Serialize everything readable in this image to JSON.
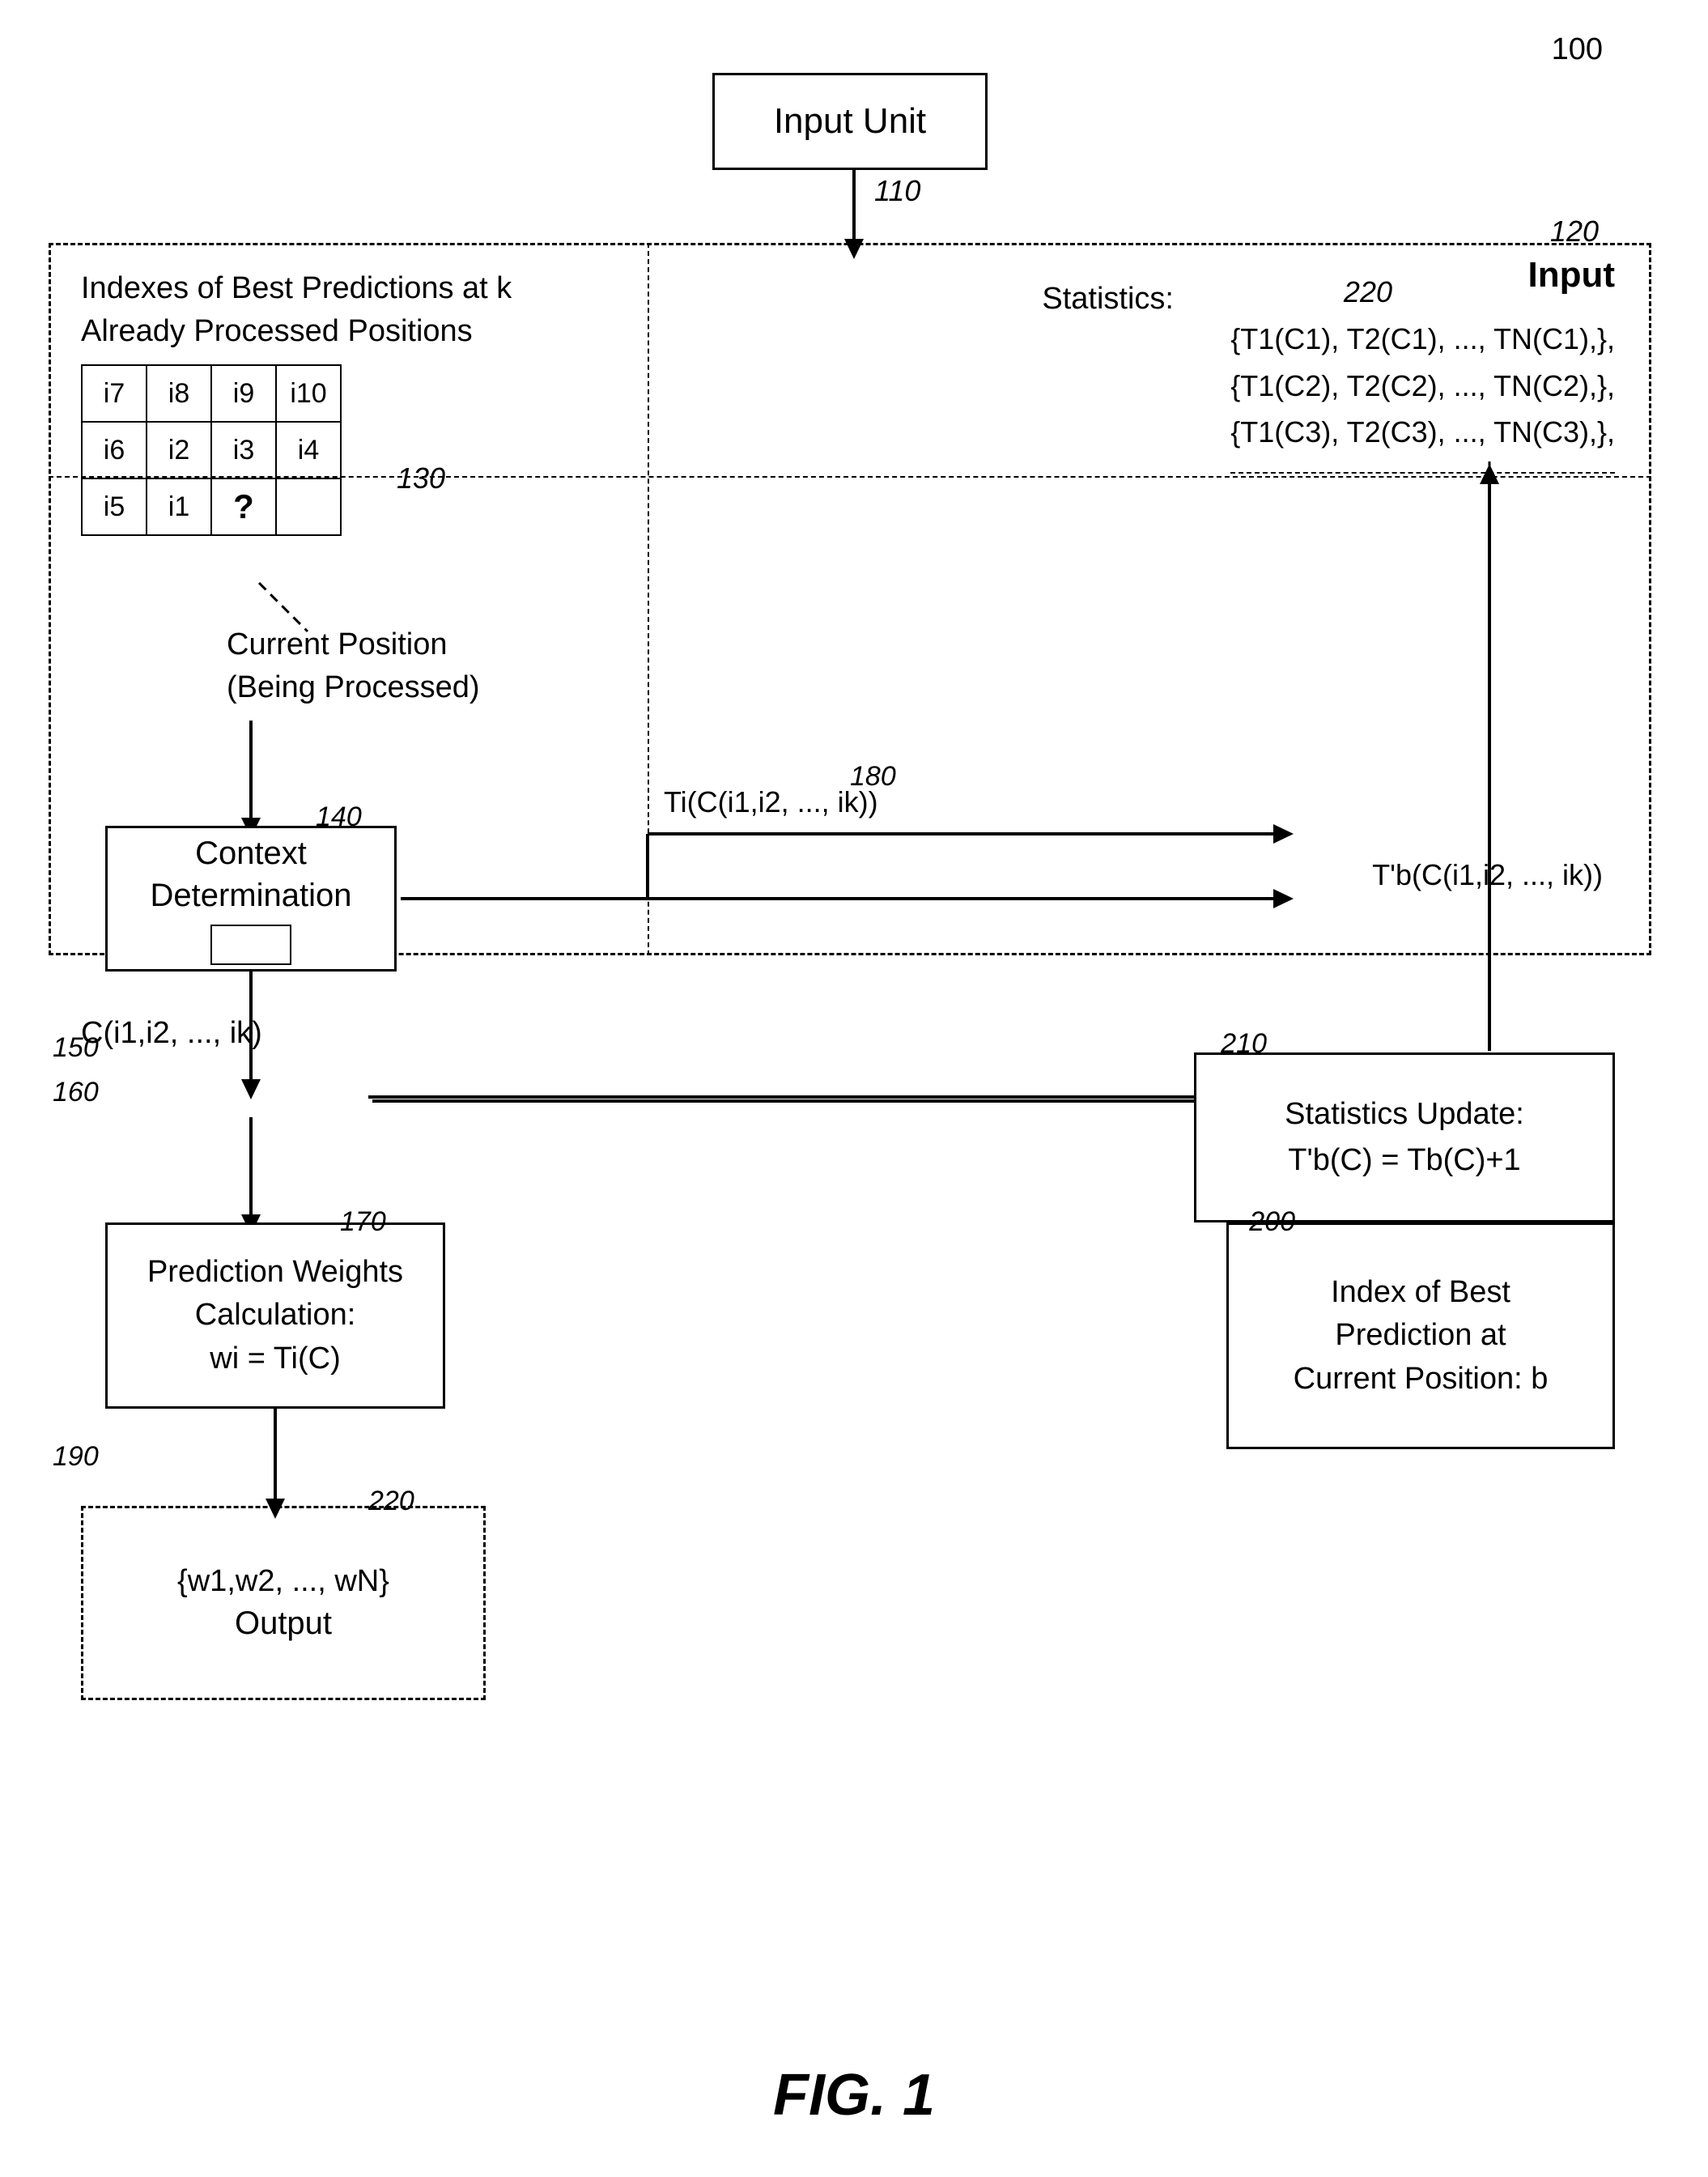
{
  "diagram": {
    "ref_100": "100",
    "fig_label": "FIG. 1",
    "input_unit": {
      "label": "Input Unit",
      "ref": "110"
    },
    "main_box": {
      "ref": "120",
      "input_label": "Input"
    },
    "indexes_text": {
      "line1": "Indexes of Best Predictions at k",
      "line2": "Already Processed Positions"
    },
    "grid": {
      "ref": "130",
      "cells": [
        [
          "i7",
          "i8",
          "i9",
          "i10"
        ],
        [
          "i6",
          "i2",
          "i3",
          "i4"
        ],
        [
          "i5",
          "i1",
          "?",
          ""
        ]
      ]
    },
    "current_pos": {
      "line1": "Current Position",
      "line2": "(Being Processed)"
    },
    "statistics": {
      "label": "Statistics:",
      "ref": "220",
      "lines": [
        "{T1(C1), T2(C1), ..., TN(C1),},",
        "{T1(C2), T2(C2), ..., TN(C2),},",
        "{T1(C3), T2(C3), ..., TN(C3),},"
      ]
    },
    "context_det": {
      "ref": "140",
      "line1": "Context",
      "line2": "Determination"
    },
    "c_label": "C(i1,i2, ..., ik)",
    "ref_150": "150",
    "ref_160": "160",
    "ti_label": "Ti(C(i1,i2, ..., ik))",
    "ref_180": "180",
    "tb_label": "T'b(C(i1,i2, ..., ik))",
    "pred_weights": {
      "ref": "170",
      "line1": "Prediction Weights",
      "line2": "Calculation:",
      "line3": "wi = Ti(C)"
    },
    "ref_190": "190",
    "stats_update": {
      "ref": "210",
      "line1": "Statistics Update:",
      "line2": "T'b(C) = Tb(C)+1"
    },
    "index_best": {
      "ref": "200",
      "line1": "Index of Best",
      "line2": "Prediction at",
      "line3": "Current Position: b"
    },
    "output_box": {
      "ref": "220",
      "content": "{w1,w2, ..., wN}",
      "label": "Output"
    }
  }
}
